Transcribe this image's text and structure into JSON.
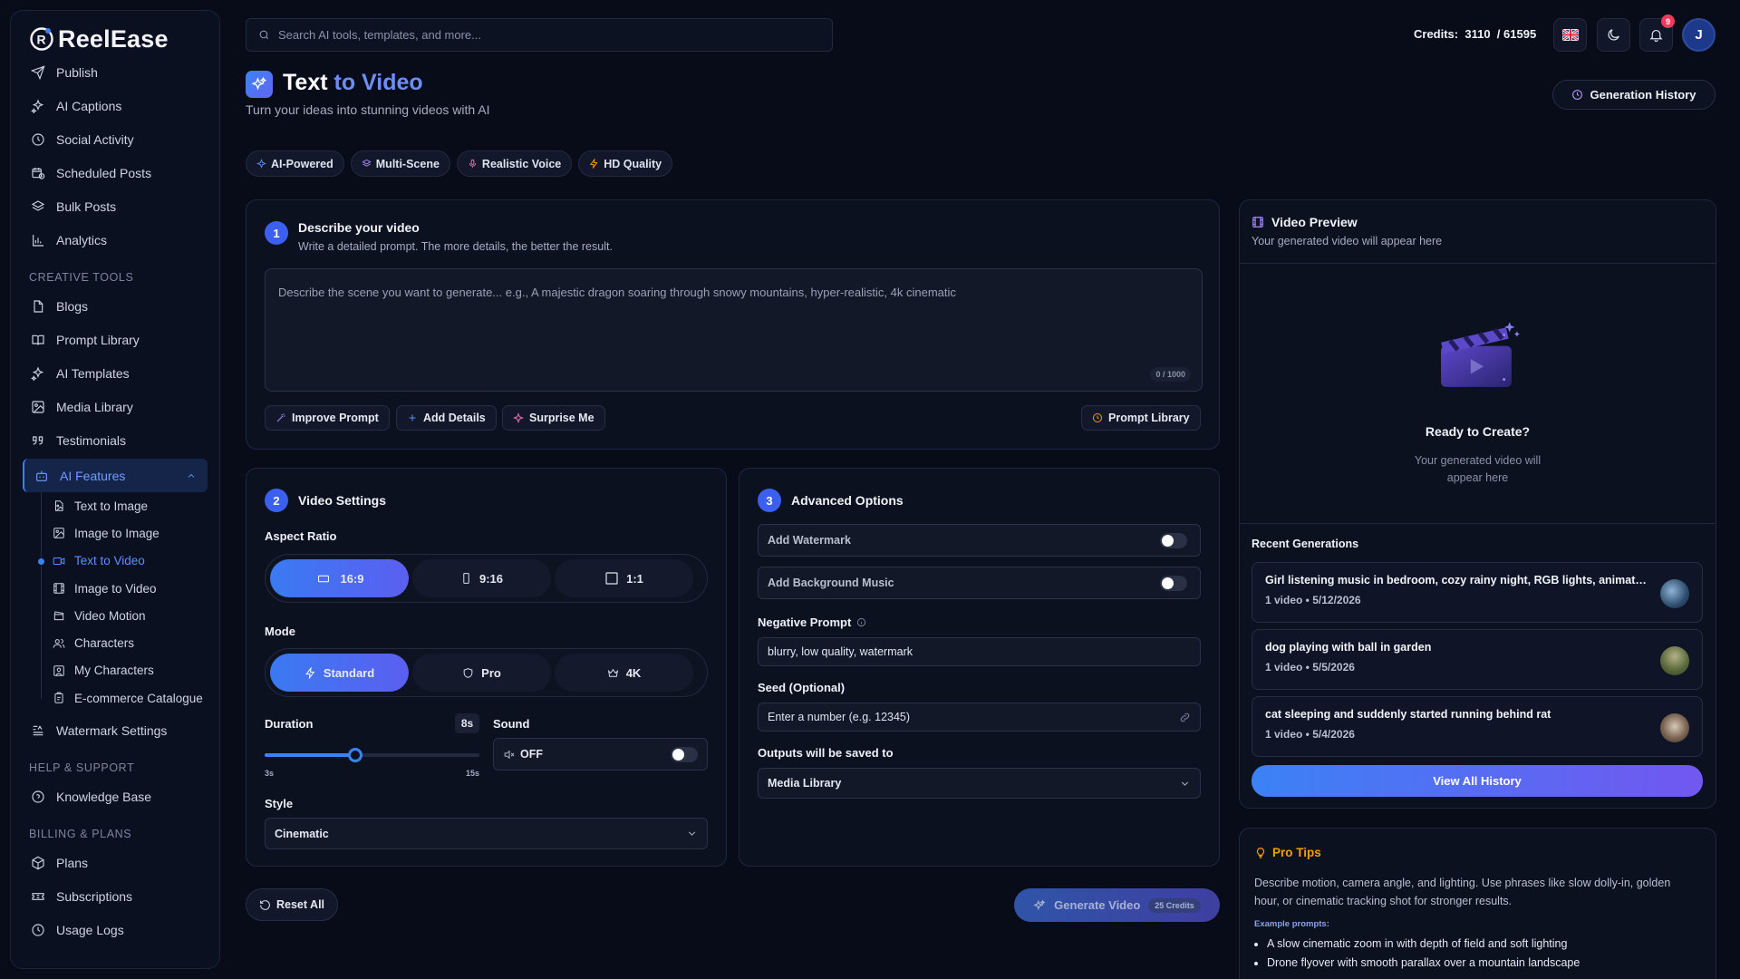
{
  "brand": {
    "name": "ReelEase"
  },
  "sidebar": {
    "top_items": [
      {
        "label": "Publish",
        "icon": "send-icon"
      },
      {
        "label": "AI Captions",
        "icon": "sparkles-icon"
      },
      {
        "label": "Social Activity",
        "icon": "clock-icon"
      },
      {
        "label": "Scheduled Posts",
        "icon": "calendar-clock-icon"
      },
      {
        "label": "Bulk Posts",
        "icon": "layers-icon"
      },
      {
        "label": "Analytics",
        "icon": "bar-chart-icon"
      }
    ],
    "creative_section": "CREATIVE TOOLS",
    "creative_items": [
      {
        "label": "Blogs",
        "icon": "file-icon"
      },
      {
        "label": "Prompt Library",
        "icon": "book-icon"
      },
      {
        "label": "AI Templates",
        "icon": "sparkles-icon"
      },
      {
        "label": "Media Library",
        "icon": "image-icon"
      },
      {
        "label": "Testimonials",
        "icon": "quote-icon"
      }
    ],
    "ai_features": {
      "label": "AI Features",
      "icon": "bot-icon"
    },
    "ai_sub_items": [
      {
        "label": "Text to Image",
        "icon": "file-image-icon",
        "active": false
      },
      {
        "label": "Image to Image",
        "icon": "image-icon",
        "active": false
      },
      {
        "label": "Text to Video",
        "icon": "video-icon",
        "active": true
      },
      {
        "label": "Image to Video",
        "icon": "film-icon",
        "active": false
      },
      {
        "label": "Video Motion",
        "icon": "clapperboard-icon",
        "active": false
      },
      {
        "label": "Characters",
        "icon": "users-icon",
        "active": false
      },
      {
        "label": "My Characters",
        "icon": "image-user-icon",
        "active": false
      },
      {
        "label": "E-commerce Catalogue",
        "icon": "clipboard-icon",
        "active": false
      }
    ],
    "watermark": {
      "label": "Watermark Settings",
      "icon": "watermark-icon"
    },
    "help_section": "HELP & SUPPORT",
    "help_items": [
      {
        "label": "Knowledge Base",
        "icon": "help-circle-icon"
      }
    ],
    "billing_section": "BILLING & PLANS",
    "billing_items": [
      {
        "label": "Plans",
        "icon": "package-icon"
      },
      {
        "label": "Subscriptions",
        "icon": "ticket-icon"
      },
      {
        "label": "Usage Logs",
        "icon": "clock-icon"
      }
    ]
  },
  "topbar": {
    "search_placeholder": "Search AI tools, templates, and more...",
    "credits_label": "Credits:",
    "credits_used": "3110",
    "credits_total": "/ 61595",
    "notification_count": "9",
    "avatar_initial": "J"
  },
  "header": {
    "title_main": "Text",
    "title_accent": "to Video",
    "subtitle": "Turn your ideas into stunning videos with AI",
    "history_button": "Generation History",
    "tags": [
      {
        "label": "AI-Powered",
        "icon": "sparkle-icon",
        "color": "#5b8cff"
      },
      {
        "label": "Multi-Scene",
        "icon": "layers-icon",
        "color": "#a78bfa"
      },
      {
        "label": "Realistic Voice",
        "icon": "mic-icon",
        "color": "#f472b6"
      },
      {
        "label": "HD Quality",
        "icon": "zap-icon",
        "color": "#f59e0b"
      }
    ]
  },
  "step1": {
    "num": "1",
    "title": "Describe your video",
    "subtitle": "Write a detailed prompt. The more details, the better the result.",
    "placeholder": "Describe the scene you want to generate... e.g., A majestic dragon soaring through snowy mountains, hyper-realistic, 4k cinematic",
    "char_count": "0 / 1000",
    "improve": "Improve Prompt",
    "add_details": "Add Details",
    "surprise": "Surprise Me",
    "prompt_library": "Prompt Library"
  },
  "step2": {
    "num": "2",
    "title": "Video Settings",
    "aspect_label": "Aspect Ratio",
    "aspect_options": [
      "16:9",
      "9:16",
      "1:1"
    ],
    "mode_label": "Mode",
    "mode_options": [
      "Standard",
      "Pro",
      "4K"
    ],
    "duration_label": "Duration",
    "duration_value": "8s",
    "duration_level": 0.42,
    "duration_min": "3s",
    "duration_max": "15s",
    "sound_label": "Sound",
    "sound_value": "OFF",
    "style_label": "Style",
    "style_value": "Cinematic"
  },
  "step3": {
    "num": "3",
    "title": "Advanced Options",
    "watermark": "Add Watermark",
    "bg_music": "Add Background Music",
    "negative_label": "Negative Prompt",
    "negative_value": "blurry, low quality, watermark",
    "seed_label": "Seed (Optional)",
    "seed_placeholder": "Enter a number (e.g. 12345)",
    "outputs_label": "Outputs will be saved to",
    "outputs_value": "Media Library"
  },
  "actions": {
    "reset": "Reset All",
    "generate": "Generate Video",
    "credits_cost": "25 Credits"
  },
  "preview": {
    "title": "Video Preview",
    "subtitle": "Your generated video will appear here",
    "ready": "Ready to Create?",
    "ready_sub_1": "Your generated video will",
    "ready_sub_2": "appear here",
    "recent_title": "Recent Generations",
    "recent": [
      {
        "title": "Girl listening music in bedroom, cozy rainy night, RGB lights, animated style",
        "meta": "1 video • 5/12/2026"
      },
      {
        "title": "dog playing with ball in garden",
        "meta": "1 video • 5/5/2026"
      },
      {
        "title": "cat sleeping and suddenly started running behind rat",
        "meta": "1 video • 5/4/2026"
      }
    ],
    "view_all": "View All History"
  },
  "tips": {
    "title": "Pro Tips",
    "body": "Describe motion, camera angle, and lighting. Use phrases like slow dolly-in, golden hour, or cinematic tracking shot for stronger results.",
    "examples_label": "Example prompts:",
    "examples": [
      "A slow cinematic zoom in with depth of field and soft lighting",
      "Drone flyover with smooth parallax over a mountain landscape"
    ]
  }
}
